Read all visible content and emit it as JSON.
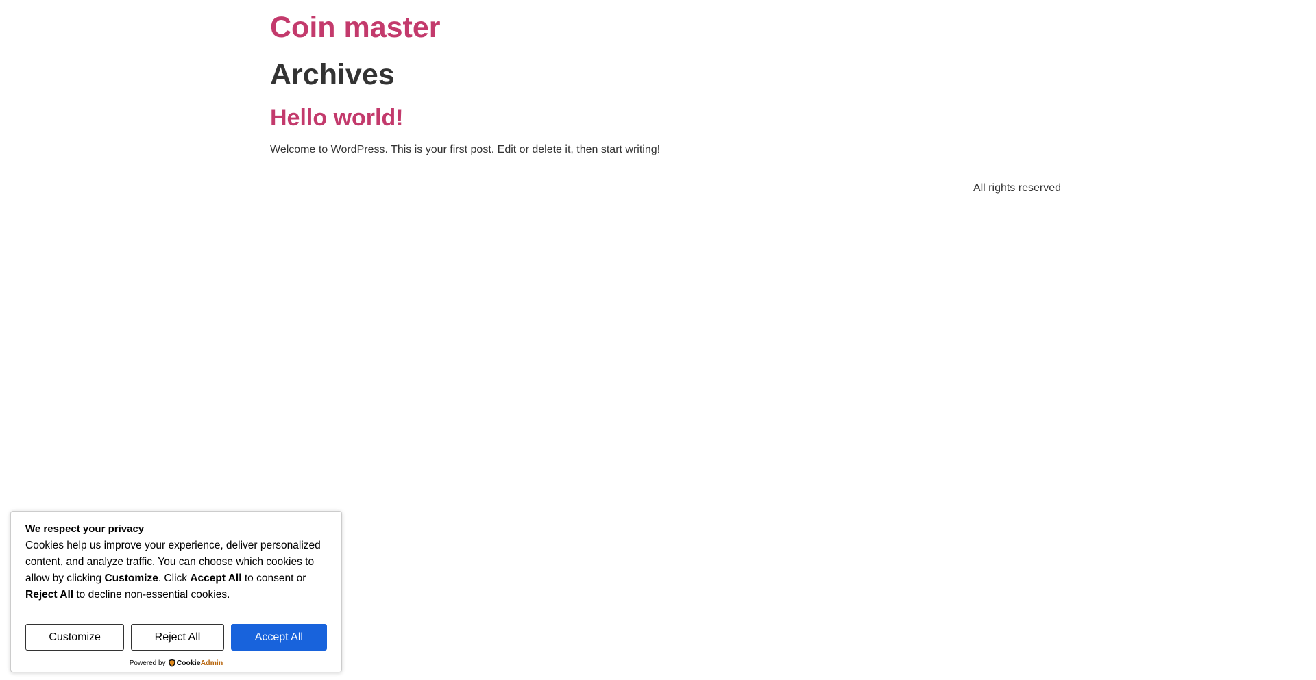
{
  "site": {
    "title": "Coin master"
  },
  "archive": {
    "title": "Archives"
  },
  "post": {
    "title": "Hello world!",
    "excerpt": "Welcome to WordPress. This is your first post. Edit or delete it, then start writing!"
  },
  "footer": {
    "text": "All rights reserved"
  },
  "cookie_banner": {
    "heading": "We respect your privacy",
    "body_part1": "Cookies help us improve your experience, deliver personalized content, and analyze traffic. You can choose which cookies to allow by clicking ",
    "body_bold1": "Customize",
    "body_part2": ". Click ",
    "body_bold2": "Accept All",
    "body_part3": " to consent or ",
    "body_bold3": "Reject All",
    "body_part4": " to decline non-essential cookies.",
    "customize_label": "Customize",
    "reject_label": "Reject All",
    "accept_label": "Accept All",
    "powered_by": "Powered by",
    "brand_part1": "Cookie",
    "brand_part2": "Admin"
  },
  "colors": {
    "link": "#c33a6c",
    "text": "#333333",
    "accept_button": "#1863dc",
    "brand_admin": "#b8660e"
  }
}
